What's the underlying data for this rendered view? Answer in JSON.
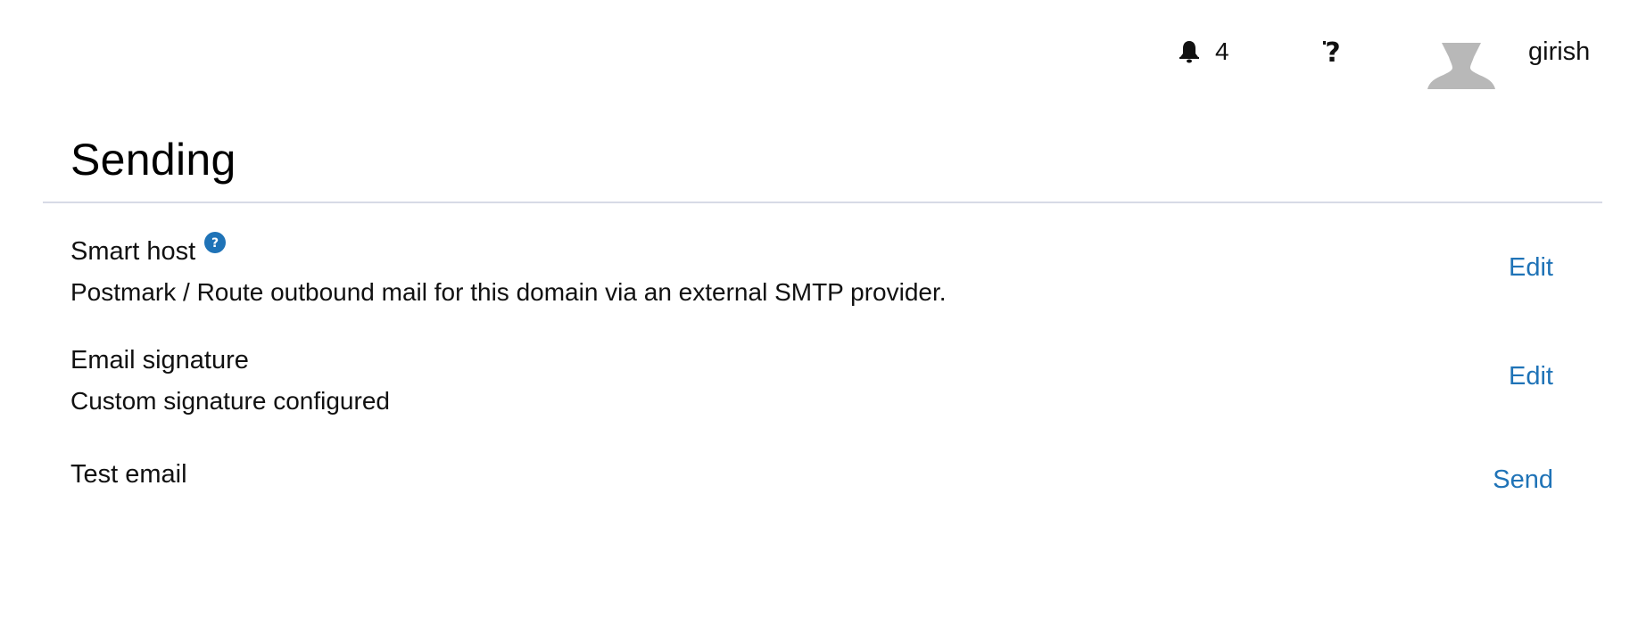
{
  "topbar": {
    "notification_count": "4",
    "username": "girish",
    "icons": {
      "notifications": "bell-icon",
      "help": "help-icon",
      "avatar": "user-avatar-icon"
    }
  },
  "page": {
    "title": "Sending"
  },
  "settings": [
    {
      "title": "Smart host",
      "description": "Postmark / Route outbound mail for this domain via an external SMTP provider.",
      "action": "Edit",
      "has_info_icon": true
    },
    {
      "title": "Email signature",
      "description": "Custom signature configured",
      "action": "Edit",
      "has_info_icon": false
    },
    {
      "title": "Test email",
      "description": "",
      "action": "Send",
      "has_info_icon": false
    }
  ],
  "colors": {
    "link": "#1f73b7",
    "divider": "#d7dae6",
    "avatar": "#b8b8b8",
    "info_icon": "#1f73b7"
  }
}
